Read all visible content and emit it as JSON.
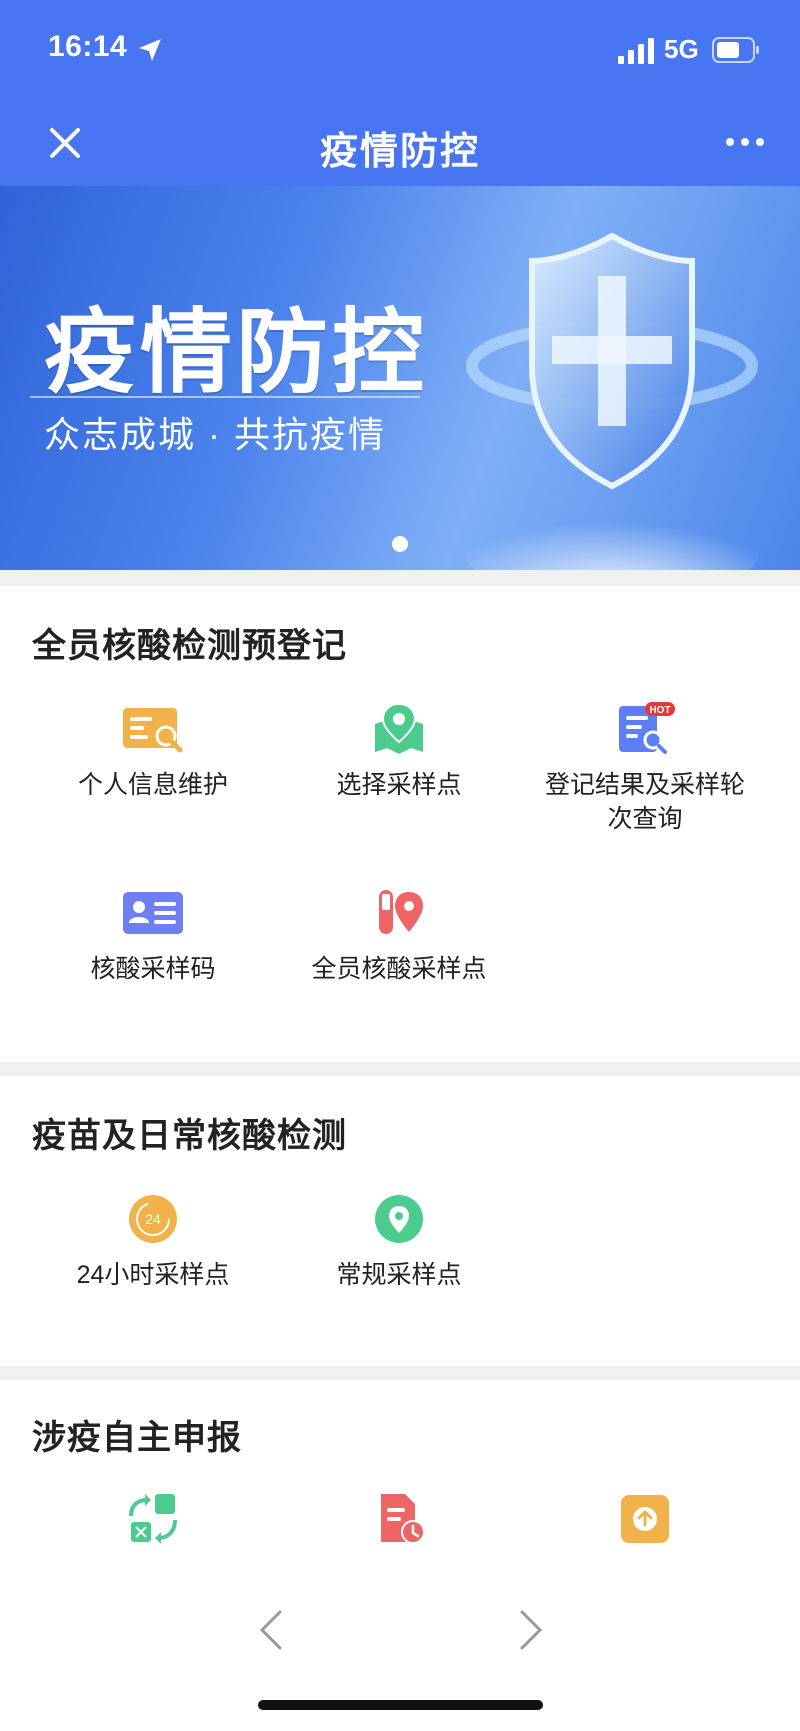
{
  "status_bar": {
    "time": "16:14",
    "network": "5G"
  },
  "nav": {
    "title": "疫情防控"
  },
  "banner": {
    "title": "疫情防控",
    "subtitle": "众志成城 · 共抗疫情"
  },
  "sections": [
    {
      "title": "全员核酸检测预登记",
      "items": [
        {
          "label": "个人信息维护",
          "icon": "id-card-search-icon",
          "color": "#f1b24a"
        },
        {
          "label": "选择采样点",
          "icon": "map-pin-icon",
          "color": "#4ccb8f"
        },
        {
          "label": "登记结果及采样轮次查询",
          "icon": "document-search-icon",
          "color": "#5d7ef5",
          "badge": "HOT"
        },
        {
          "label": "核酸采样码",
          "icon": "id-card-icon",
          "color": "#6e7ff2"
        },
        {
          "label": "全员核酸采样点",
          "icon": "test-tube-pin-icon",
          "color": "#ef6565"
        }
      ]
    },
    {
      "title": "疫苗及日常核酸检测",
      "items": [
        {
          "label": "24小时采样点",
          "icon": "clock-24-icon",
          "color": "#f1b24a",
          "icon_text": "24"
        },
        {
          "label": "常规采样点",
          "icon": "location-pin-icon",
          "color": "#4ccb8f"
        }
      ]
    },
    {
      "title": "涉疫自主申报",
      "items": [
        {
          "icon": "swap-icon",
          "color": "#4ccb8f"
        },
        {
          "icon": "document-clock-icon",
          "color": "#ef6565"
        },
        {
          "icon": "upload-icon",
          "color": "#f1b24a"
        }
      ]
    }
  ],
  "colors": {
    "primary": "#4876f2",
    "background": "#f0f0f0"
  }
}
